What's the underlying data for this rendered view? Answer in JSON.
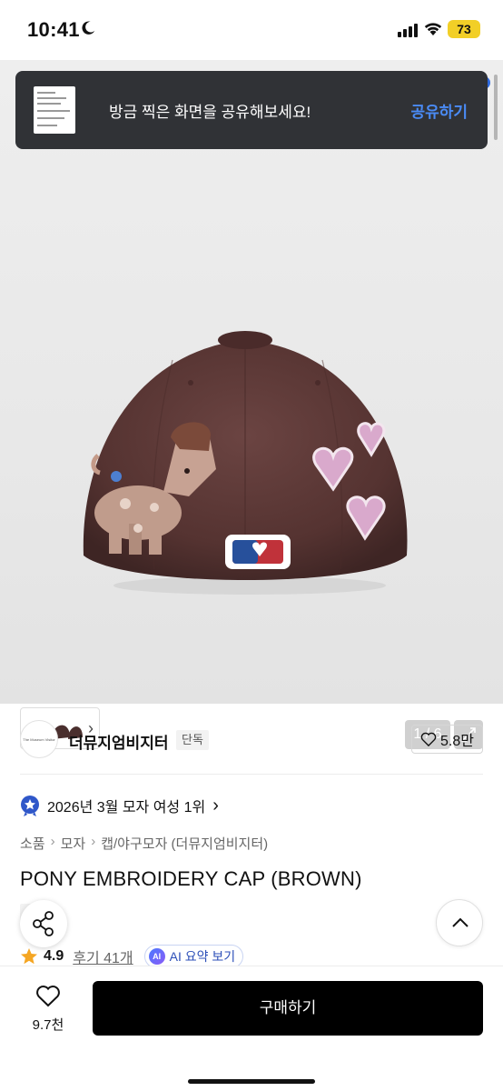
{
  "status_bar": {
    "time": "10:41",
    "battery": "73",
    "icons": [
      "moon-icon",
      "signal-icon",
      "wifi-icon",
      "battery-icon"
    ]
  },
  "toast": {
    "message": "방금 찍은 화면을 공유해보세요!",
    "action": "공유하기"
  },
  "gallery": {
    "counter": "1 / 6",
    "current": 1,
    "total": 6
  },
  "brand": {
    "name": "더뮤지엄비지터",
    "badge": "단독",
    "logo_text": "The Museum Visitor",
    "likes": "5.8만"
  },
  "ranking": {
    "text": "2026년 3월 모자 여성 1위"
  },
  "breadcrumb": [
    "소품",
    "모자",
    "캡/야구모자 (더뮤지엄비지터)"
  ],
  "product": {
    "title": "PONY EMBROIDERY CAP (BROWN)",
    "badge": "단독"
  },
  "rating": {
    "value": "4.9",
    "reviews": "후기 41개",
    "ai_label": "AI 요약 보기",
    "ai_icon_text": "AI"
  },
  "bottom_bar": {
    "wish_count": "9.7천",
    "buy_label": "구매하기"
  },
  "colors": {
    "cap_brown": "#5a3634",
    "toast_bg": "#303236",
    "toast_action": "#4a8bf5",
    "buy_bg": "#000000",
    "battery": "#f2cf27"
  }
}
